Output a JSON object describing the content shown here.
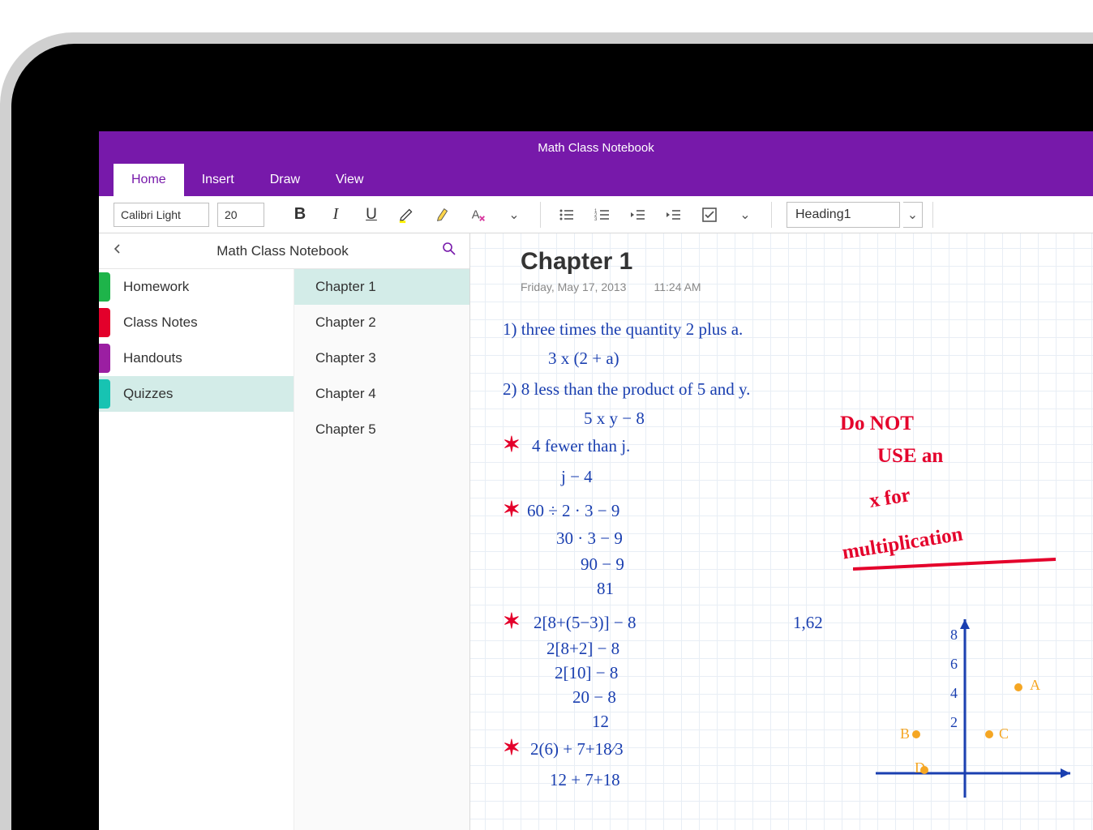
{
  "app": {
    "title": "Math Class Notebook"
  },
  "tabs": [
    "Home",
    "Insert",
    "Draw",
    "View"
  ],
  "ribbon": {
    "font_name": "Calibri Light",
    "font_size": "20",
    "style_name": "Heading1"
  },
  "nav": {
    "notebook_title": "Math Class Notebook",
    "sections": [
      {
        "label": "Homework",
        "color": "#1eb44a"
      },
      {
        "label": "Class Notes",
        "color": "#e3002b"
      },
      {
        "label": "Handouts",
        "color": "#9b1fa2"
      },
      {
        "label": "Quizzes",
        "color": "#17c3b2",
        "selected": true
      }
    ],
    "pages": [
      {
        "label": "Chapter 1",
        "selected": true
      },
      {
        "label": "Chapter 2"
      },
      {
        "label": "Chapter 3"
      },
      {
        "label": "Chapter 4"
      },
      {
        "label": "Chapter 5"
      }
    ]
  },
  "page": {
    "title": "Chapter 1",
    "date": "Friday, May 17, 2013",
    "time": "11:24 AM",
    "handwriting": [
      "1) three times the quantity 2 plus a.",
      "3 x (2 + a)",
      "2) 8 less than the product of 5 and y.",
      "5 x y − 8",
      "4 fewer than j.",
      "j − 4",
      "60 ÷ 2 · 3 − 9",
      "30 · 3 − 9",
      "90 − 9",
      "81",
      "2[8+(5−3)] − 8",
      "2[8+2] − 8",
      "2[10] − 8",
      "20 − 8",
      "12",
      "2(6) + 7+18⁄3",
      "12 + 7+18",
      "1,62"
    ],
    "red_note": [
      "Do NOT",
      "USE an",
      "x for",
      "multiplication"
    ],
    "axis_ticks": [
      "8",
      "6",
      "4",
      "2"
    ],
    "axis_points": [
      "A",
      "B",
      "C",
      "D"
    ]
  }
}
